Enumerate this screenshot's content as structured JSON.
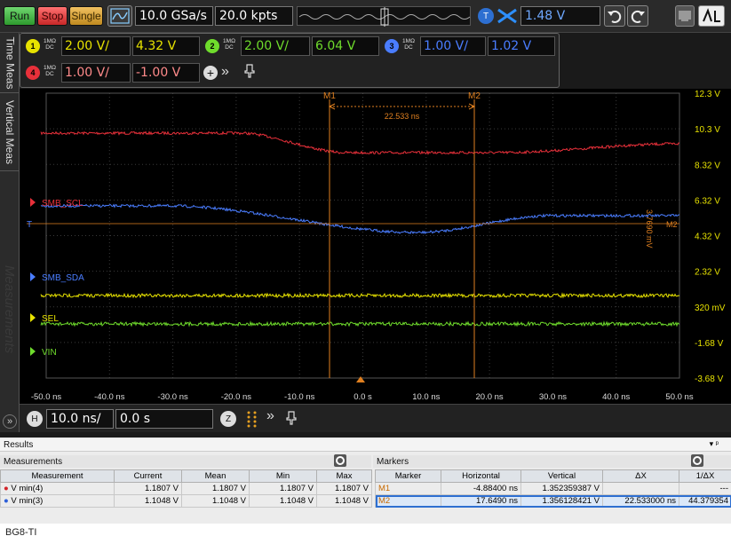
{
  "toolbar": {
    "run": "Run",
    "stop": "Stop",
    "single": "Single",
    "sample_rate": "10.0 GSa/s",
    "memory_depth": "20.0 kpts",
    "trigger_badge": "T",
    "trigger_level": "1.48 V"
  },
  "channels": [
    {
      "num": "1",
      "coupling": "1MΩ",
      "dc": "DC",
      "scale": "2.00 V/",
      "offset": "4.32 V",
      "color": "#e7e200"
    },
    {
      "num": "2",
      "coupling": "1MΩ",
      "dc": "DC",
      "scale": "2.00 V/",
      "offset": "6.04 V",
      "color": "#6fdc2c"
    },
    {
      "num": "3",
      "coupling": "1MΩ",
      "dc": "DC",
      "scale": "1.00 V/",
      "offset": "1.02 V",
      "color": "#4a7dff"
    },
    {
      "num": "4",
      "coupling": "1MΩ",
      "dc": "DC",
      "scale": "1.00 V/",
      "offset": "-1.00 V",
      "color": "#e8303a"
    }
  ],
  "side_tabs": [
    "Time Meas",
    "Vertical Meas"
  ],
  "watermark": "Measurements",
  "plot": {
    "y_labels": [
      "12.3 V",
      "10.3 V",
      "8.32 V",
      "6.32 V",
      "4.32 V",
      "2.32 V",
      "320 mV",
      "-1.68 V",
      "-3.68 V"
    ],
    "x_labels": [
      "-50.0 ns",
      "-40.0 ns",
      "-30.0 ns",
      "-20.0 ns",
      "-10.0 ns",
      "0.0 s",
      "10.0 ns",
      "20.0 ns",
      "30.0 ns",
      "40.0 ns",
      "50.0 ns"
    ],
    "marker_m1": "M1",
    "marker_m2": "M2",
    "delta_x": "22.533 ns",
    "delta_y": "3.7690 mV",
    "trace_labels": [
      "SMB_SCL",
      "SMB_SDA",
      "SEL",
      "VIN"
    ],
    "trig_marker": "T"
  },
  "hbar": {
    "h_badge": "H",
    "timebase": "10.0 ns/",
    "delay": "0.0 s"
  },
  "results": {
    "title": "Results",
    "measurements_title": "Measurements",
    "markers_title": "Markers",
    "meas_headers": [
      "Measurement",
      "Current",
      "Mean",
      "Min",
      "Max"
    ],
    "meas_rows": [
      {
        "name": "V min(4)",
        "current": "1.1807 V",
        "mean": "1.1807 V",
        "min": "1.1807 V",
        "max": "1.1807 V",
        "color": "#d2232a"
      },
      {
        "name": "V min(3)",
        "current": "1.1048 V",
        "mean": "1.1048 V",
        "min": "1.1048 V",
        "max": "1.1048 V",
        "color": "#2d5fd8"
      }
    ],
    "marker_headers": [
      "Marker",
      "Horizontal",
      "Vertical",
      "ΔX",
      "1/ΔX"
    ],
    "marker_rows": [
      {
        "name": "M1",
        "h": "-4.88400 ns",
        "v": "1.352359387 V",
        "dx": "",
        "inv": "---"
      },
      {
        "name": "M2",
        "h": "17.6490 ns",
        "v": "1.356128421 V",
        "dx": "22.533000 ns",
        "inv": "44.379354"
      }
    ]
  },
  "caption": "BG8-TI"
}
